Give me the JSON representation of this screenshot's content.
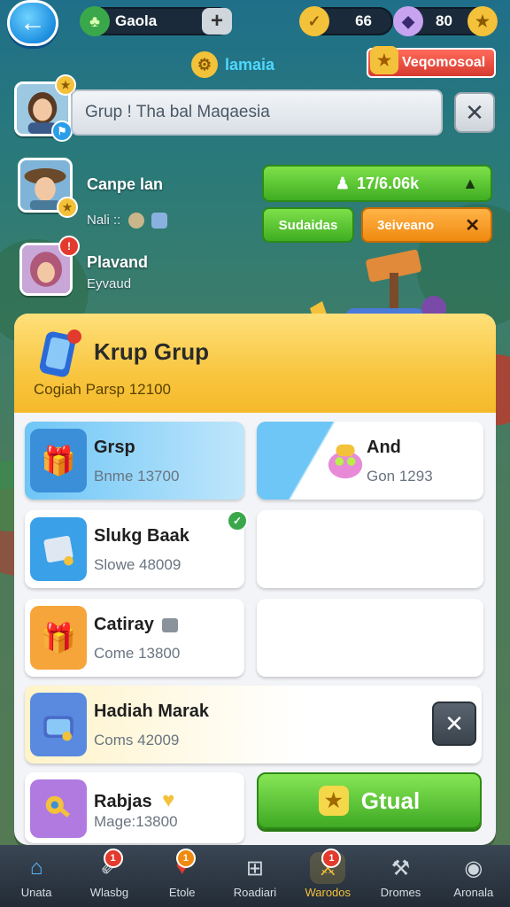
{
  "topbar": {
    "back_icon": "back-arrow-icon",
    "clover_label": "Gaola",
    "coin_value": "66",
    "gem_value": "80",
    "plus": "+"
  },
  "subbar": {
    "title": "lamaia",
    "notice_label": "Veqomosoal"
  },
  "search": {
    "value": "Grup ! Tha bal Maqaesia",
    "close": "✕"
  },
  "friends": [
    {
      "name": "Canpe lan",
      "sub": "Nali ::",
      "action_main": "17/6.06k",
      "btn_green": "Sudaidas",
      "btn_orange": "3eiveano",
      "btn_close": "✕"
    },
    {
      "name": "Plavand",
      "sub": "Eyvaud"
    }
  ],
  "panel": {
    "title": "Krup Grup",
    "subtitle": "Cogiah Parsp 12100",
    "cards": [
      {
        "title": "Grsp",
        "sub": "Bnme 13700"
      },
      {
        "title": "And",
        "sub": "Gon 1293"
      },
      {
        "title": "Slukg Baak",
        "sub": "Slowe 48009"
      },
      {
        "title": "Catiray",
        "sub": "Come 13800"
      },
      {
        "title": "Hadiah Marak",
        "sub": "Coms 42009"
      },
      {
        "title": "Rabjas",
        "sub": "Mage:13800"
      }
    ],
    "big_button": "Gtual",
    "card_close": "✕"
  },
  "nav": [
    {
      "label": "Unata",
      "badge": ""
    },
    {
      "label": "Wlasbg",
      "badge": "1"
    },
    {
      "label": "Etole",
      "badge": "1"
    },
    {
      "label": "Roadiari",
      "badge": ""
    },
    {
      "label": "Warodos",
      "badge": "1"
    },
    {
      "label": "Dromes",
      "badge": ""
    },
    {
      "label": "Aronala",
      "badge": ""
    }
  ],
  "colors": {
    "accent_green": "#3fae22",
    "accent_orange": "#f59a1a",
    "accent_red": "#e33a2e",
    "panel_header": "#f8c640",
    "active_nav": "#f4c13a"
  }
}
